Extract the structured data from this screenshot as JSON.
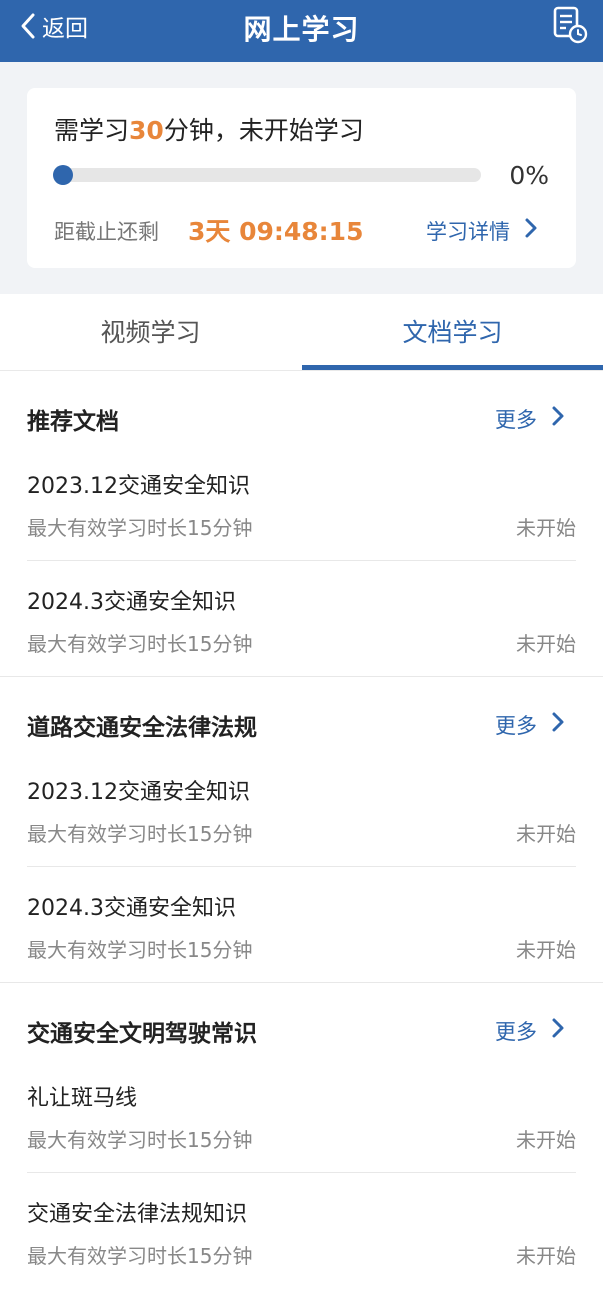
{
  "header": {
    "back_label": "返回",
    "title": "网上学习",
    "record_icon": "document-clock-icon"
  },
  "summary": {
    "need_prefix": "需学习",
    "need_minutes": "30",
    "need_suffix": "分钟，未开始学习",
    "progress_percent_text": "0%",
    "progress_fraction": 0,
    "remain_label": "距截止还剩",
    "countdown": "3天 09:48:15",
    "detail_label": "学习详情"
  },
  "tabs": [
    {
      "label": "视频学习",
      "active": false
    },
    {
      "label": "文档学习",
      "active": true
    }
  ],
  "sections": [
    {
      "title": "推荐文档",
      "more": "更多",
      "items": [
        {
          "title": "2023.12交通安全知识",
          "sub": "最大有效学习时长15分钟",
          "status": "未开始"
        },
        {
          "title": "2024.3交通安全知识",
          "sub": "最大有效学习时长15分钟",
          "status": "未开始"
        }
      ]
    },
    {
      "title": "道路交通安全法律法规",
      "more": "更多",
      "items": [
        {
          "title": "2023.12交通安全知识",
          "sub": "最大有效学习时长15分钟",
          "status": "未开始"
        },
        {
          "title": "2024.3交通安全知识",
          "sub": "最大有效学习时长15分钟",
          "status": "未开始"
        }
      ]
    },
    {
      "title": "交通安全文明驾驶常识",
      "more": "更多",
      "items": [
        {
          "title": "礼让斑马线",
          "sub": "最大有效学习时长15分钟",
          "status": "未开始"
        },
        {
          "title": "交通安全法律法规知识",
          "sub": "最大有效学习时长15分钟",
          "status": "未开始"
        }
      ]
    }
  ],
  "colors": {
    "brand_blue": "#2f66ad",
    "accent_orange": "#e8863a"
  }
}
